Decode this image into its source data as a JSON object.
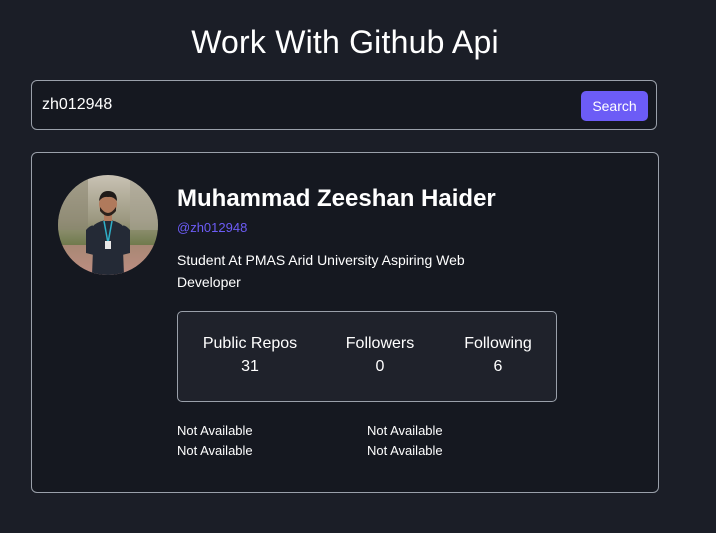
{
  "header": {
    "title": "Work With Github Api"
  },
  "search": {
    "value": "zh012948",
    "button_label": "Search"
  },
  "profile": {
    "name": "Muhammad Zeeshan Haider",
    "login": "@zh012948",
    "bio": "Student At PMAS Arid University Aspiring Web Developer",
    "stats": {
      "repos_label": "Public Repos",
      "repos_value": "31",
      "followers_label": "Followers",
      "followers_value": "0",
      "following_label": "Following",
      "following_value": "6"
    },
    "extra": {
      "field1": "Not Available",
      "field2": "Not Available",
      "field3": "Not Available",
      "field4": "Not Available"
    }
  },
  "colors": {
    "accent": "#6c5cf6",
    "background": "#1b1e27",
    "card": "#151820",
    "border": "#9aa0aa"
  }
}
